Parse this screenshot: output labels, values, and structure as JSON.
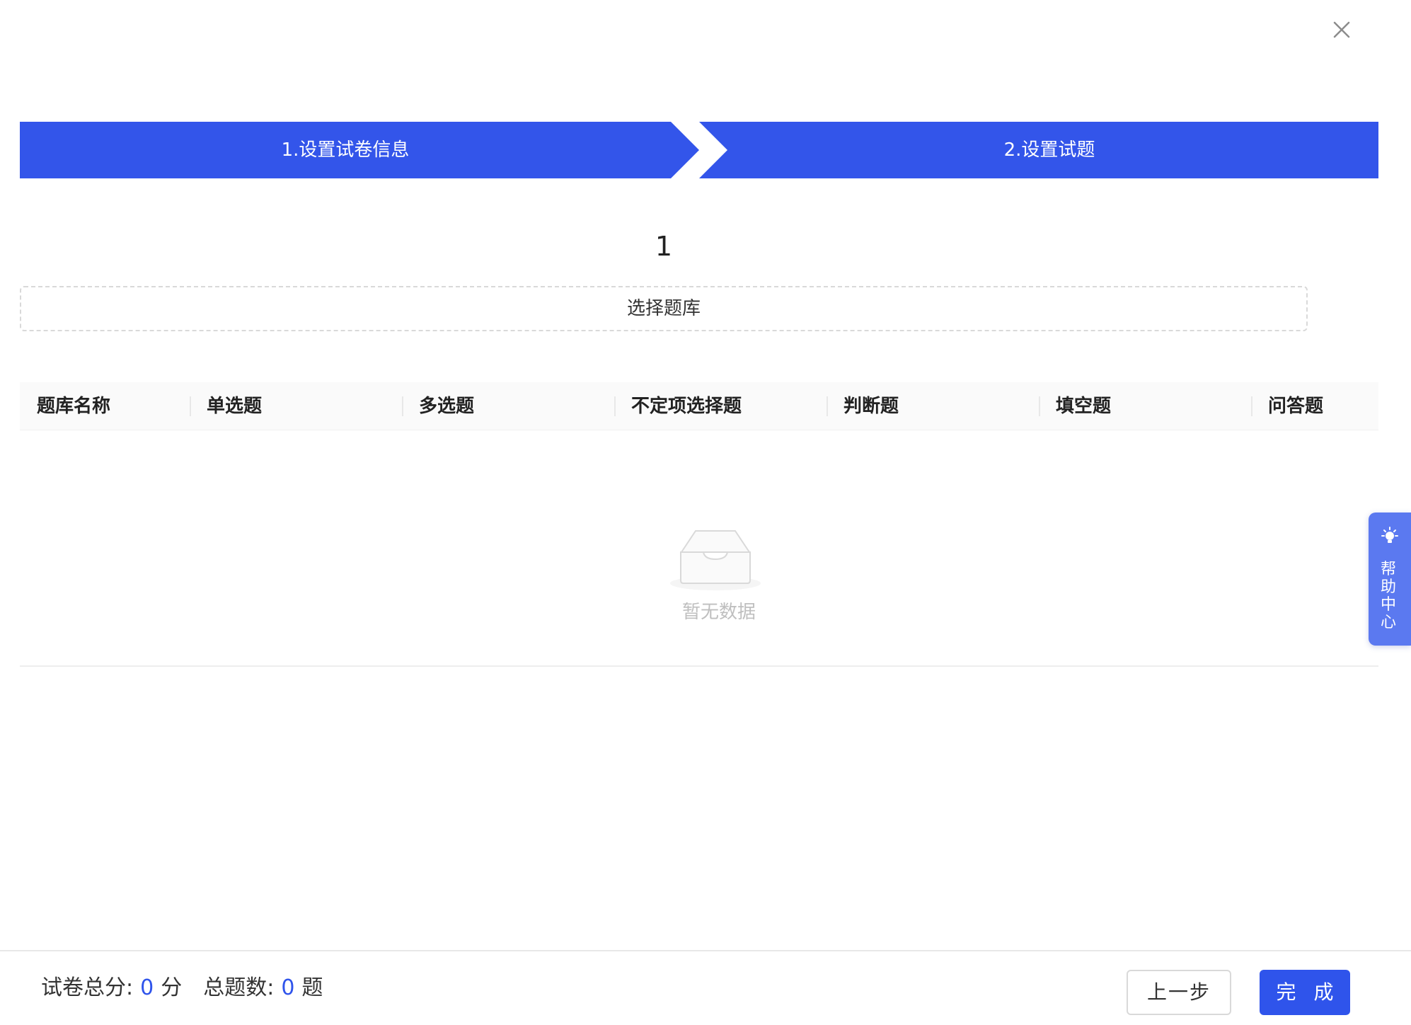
{
  "dialog": {
    "close_label": "close"
  },
  "steps": [
    {
      "label": "1.设置试卷信息"
    },
    {
      "label": "2.设置试题"
    }
  ],
  "colors": {
    "primary": "#2f54eb",
    "step_bar": "#3355ea",
    "help_tab": "#5b79f0"
  },
  "group": {
    "number": "1",
    "select_bank_label": "选择题库"
  },
  "table": {
    "columns": [
      "题库名称",
      "单选题",
      "多选题",
      "不定项选择题",
      "判断题",
      "填空题",
      "问答题"
    ],
    "rows": [],
    "empty_text": "暂无数据"
  },
  "help": {
    "label": "帮助中心",
    "icon": "lightbulb-icon"
  },
  "footer": {
    "total_score_label": "试卷总分:",
    "total_score_value": "0",
    "total_score_unit": "分",
    "total_count_label": "总题数:",
    "total_count_value": "0",
    "total_count_unit": "题",
    "prev_label": "上一步",
    "done_label": "完 成"
  }
}
